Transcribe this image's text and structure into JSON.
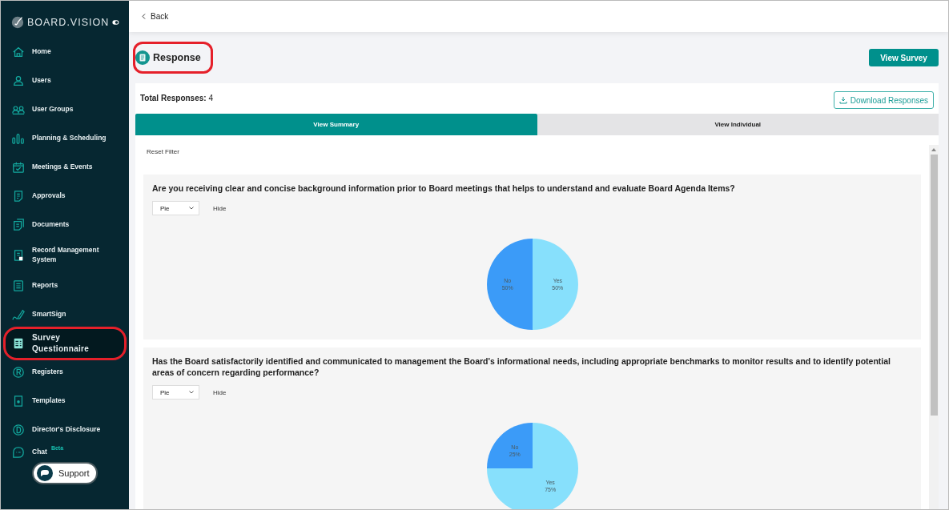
{
  "sidebar": {
    "logo": "BOARD.VISION",
    "items": [
      {
        "label": "Home",
        "selected": false,
        "annotated": false
      },
      {
        "label": "Users",
        "selected": false,
        "annotated": false
      },
      {
        "label": "User Groups",
        "selected": false,
        "annotated": false
      },
      {
        "label": "Planning & Scheduling",
        "selected": false,
        "annotated": false
      },
      {
        "label": "Meetings & Events",
        "selected": false,
        "annotated": false
      },
      {
        "label": "Approvals",
        "selected": false,
        "annotated": false
      },
      {
        "label": "Documents",
        "selected": false,
        "annotated": false
      },
      {
        "label": "Record Management System",
        "selected": false,
        "annotated": false
      },
      {
        "label": "Reports",
        "selected": false,
        "annotated": false
      },
      {
        "label": "SmartSign",
        "selected": false,
        "annotated": false
      },
      {
        "label": "Survey Questionnaire",
        "selected": true,
        "annotated": true
      },
      {
        "label": "Registers",
        "selected": false,
        "annotated": false
      },
      {
        "label": "Templates",
        "selected": false,
        "annotated": false
      },
      {
        "label": "Director's Disclosure",
        "selected": false,
        "annotated": false
      },
      {
        "label": "Chat",
        "badge": "Beta",
        "selected": false,
        "annotated": false
      }
    ],
    "support_button": "Support"
  },
  "top_bar": {
    "back_link": "Back"
  },
  "header": {
    "title": "Response",
    "title_annotated": true,
    "view_survey_button": "View Survey"
  },
  "summary": {
    "total_label": "Total Responses:",
    "total_value": "4",
    "download_button": "Download Responses"
  },
  "tabs": [
    {
      "label": "View Summary",
      "selected": true
    },
    {
      "label": "View Individual",
      "selected": false
    }
  ],
  "reset_filter": "Reset Filter",
  "questions": [
    {
      "text": "Are you receiving clear and concise background information prior to Board meetings that helps to understand and evaluate Board Agenda Items?",
      "chart_type": "Pie",
      "hide_label": "Hide",
      "chart_data": {
        "type": "pie",
        "categories": [
          "Yes",
          "No"
        ],
        "values": [
          50,
          50
        ],
        "colors": [
          "#87e0fc",
          "#3b9bf8"
        ],
        "data_labels": true,
        "value_labels": [
          "50%",
          "50%"
        ]
      }
    },
    {
      "text": "Has the Board satisfactorily identified and communicated to management the Board's informational needs, including appropriate benchmarks to monitor results and to identify potential areas of concern regarding performance?",
      "chart_type": "Pie",
      "hide_label": "Hide",
      "chart_data": {
        "type": "pie",
        "categories": [
          "Yes",
          "No"
        ],
        "values": [
          75,
          25
        ],
        "colors": [
          "#87e0fc",
          "#3b9bf8"
        ],
        "data_labels": true,
        "value_labels": [
          "75%",
          "25%"
        ]
      }
    }
  ]
}
